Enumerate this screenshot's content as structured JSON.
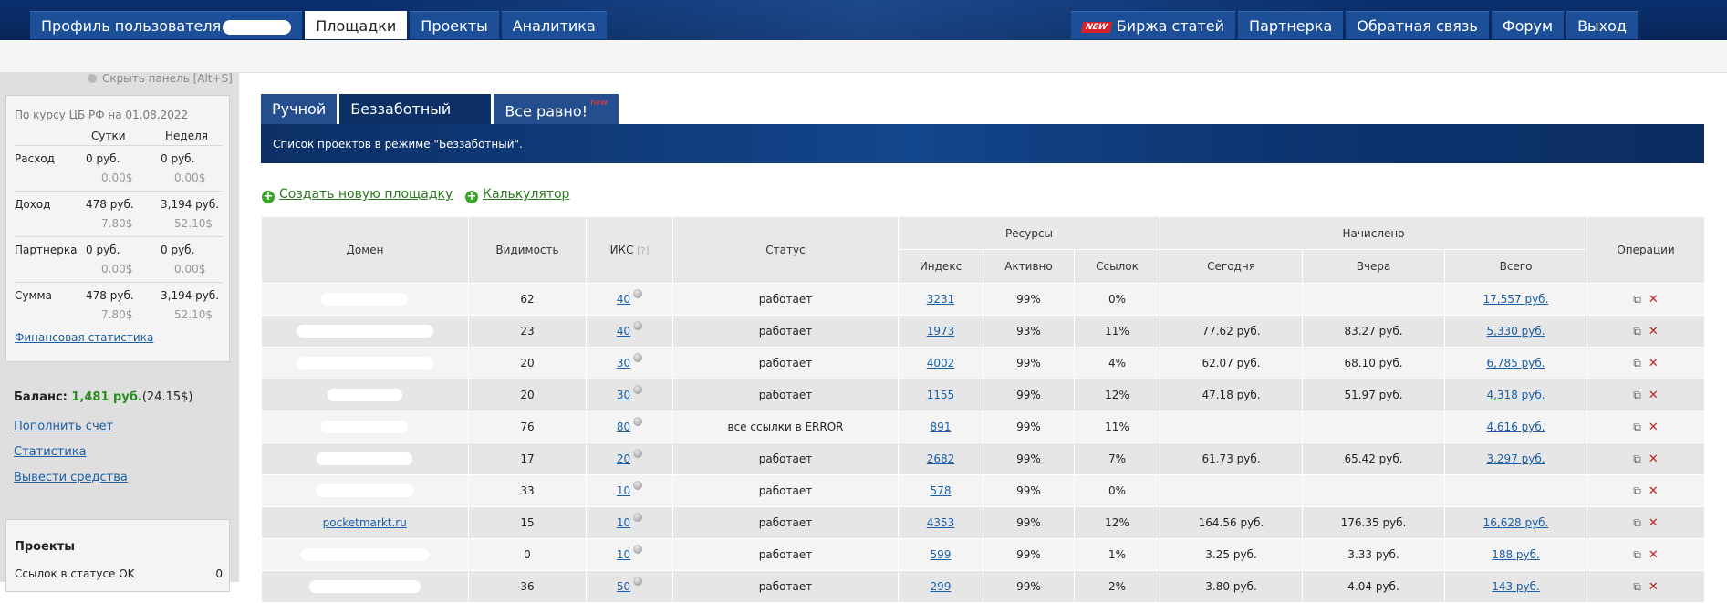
{
  "topnav": {
    "left": [
      {
        "label": "Профиль пользователя",
        "active": false
      },
      {
        "label": "Площадки",
        "active": true
      },
      {
        "label": "Проекты",
        "active": false
      },
      {
        "label": "Аналитика",
        "active": false
      }
    ],
    "right": [
      {
        "label": "Биржа статей",
        "badge": "NEW"
      },
      {
        "label": "Партнерка"
      },
      {
        "label": "Обратная связь"
      },
      {
        "label": "Форум"
      },
      {
        "label": "Выход"
      }
    ]
  },
  "sidebar": {
    "hide_panel": "Скрыть панель [Alt+S]",
    "fin": {
      "date": "По курсу ЦБ РФ на 01.08.2022",
      "col_day": "Сутки",
      "col_week": "Неделя",
      "rows": [
        {
          "label": "Расход",
          "day": "0 руб.",
          "week": "0 руб.",
          "day_usd": "0.00$",
          "week_usd": "0.00$"
        },
        {
          "label": "Доход",
          "day": "478 руб.",
          "week": "3,194 руб.",
          "day_usd": "7.80$",
          "week_usd": "52.10$"
        },
        {
          "label": "Партнерка",
          "day": "0 руб.",
          "week": "0 руб.",
          "day_usd": "0.00$",
          "week_usd": "0.00$"
        },
        {
          "label": "Сумма",
          "day": "478 руб.",
          "week": "3,194 руб.",
          "day_usd": "7.80$",
          "week_usd": "52.10$"
        }
      ],
      "link": "Финансовая статистика"
    },
    "balance_label": "Баланс:",
    "balance_value": "1,481 руб.",
    "balance_usd": "(24.15$)",
    "links": [
      "Пополнить счет",
      "Статистика",
      "Вывести средства"
    ],
    "projects_title": "Проекты",
    "projects_row_label": "Ссылок в статусе OK",
    "projects_row_value": "0"
  },
  "main": {
    "tabs": [
      {
        "label": "Ручной"
      },
      {
        "label": "Беззаботный",
        "active": true
      },
      {
        "label": "Все равно!",
        "sup": "new"
      }
    ],
    "banner": "Список проектов в режиме \"Беззаботный\".",
    "actions": [
      "Создать новую площадку",
      "Калькулятор"
    ],
    "table": {
      "headers": {
        "domain": "Домен",
        "visibility": "Видимость",
        "iks": "ИКС",
        "iks_q": "[?]",
        "status": "Статус",
        "resources": "Ресурсы",
        "accrued": "Начислено",
        "ops": "Операции",
        "index": "Индекс",
        "active": "Активно",
        "links": "Ссылок",
        "today": "Сегодня",
        "yesterday": "Вчера",
        "total": "Всего"
      },
      "rows": [
        {
          "domain": "",
          "vis": "62",
          "iks": "40",
          "status": "работает",
          "index": "3231",
          "active": "99%",
          "links": "0%",
          "today": "",
          "yesterday": "",
          "total": "17,557 руб."
        },
        {
          "domain": "",
          "vis": "23",
          "iks": "40",
          "status": "работает",
          "index": "1973",
          "active": "93%",
          "links": "11%",
          "today": "77.62 руб.",
          "yesterday": "83.27 руб.",
          "total": "5,330 руб."
        },
        {
          "domain": "",
          "vis": "20",
          "iks": "30",
          "status": "работает",
          "index": "4002",
          "active": "99%",
          "links": "4%",
          "today": "62.07 руб.",
          "yesterday": "68.10 руб.",
          "total": "6,785 руб."
        },
        {
          "domain": "",
          "vis": "20",
          "iks": "30",
          "status": "работает",
          "index": "1155",
          "active": "99%",
          "links": "12%",
          "today": "47.18 руб.",
          "yesterday": "51.97 руб.",
          "total": "4,318 руб."
        },
        {
          "domain": "",
          "vis": "76",
          "iks": "80",
          "status": "все ссылки в ERROR",
          "index": "891",
          "active": "99%",
          "links": "11%",
          "today": "",
          "yesterday": "",
          "total": "4,616 руб."
        },
        {
          "domain": "",
          "vis": "17",
          "iks": "20",
          "status": "работает",
          "index": "2682",
          "active": "99%",
          "links": "7%",
          "today": "61.73 руб.",
          "yesterday": "65.42 руб.",
          "total": "3,297 руб."
        },
        {
          "domain": "",
          "vis": "33",
          "iks": "10",
          "status": "работает",
          "index": "578",
          "active": "99%",
          "links": "0%",
          "today": "",
          "yesterday": "",
          "total": ""
        },
        {
          "domain": "pocketmarkt.ru",
          "vis": "15",
          "iks": "10",
          "status": "работает",
          "index": "4353",
          "active": "99%",
          "links": "12%",
          "today": "164.56 руб.",
          "yesterday": "176.35 руб.",
          "total": "16,628 руб."
        },
        {
          "domain": "",
          "vis": "0",
          "iks": "10",
          "status": "работает",
          "index": "599",
          "active": "99%",
          "links": "1%",
          "today": "3.25 руб.",
          "yesterday": "3.33 руб.",
          "total": "188 руб."
        },
        {
          "domain": "",
          "vis": "36",
          "iks": "50",
          "status": "работает",
          "index": "299",
          "active": "99%",
          "links": "2%",
          "today": "3.80 руб.",
          "yesterday": "4.04 руб.",
          "total": "143 руб."
        }
      ]
    }
  },
  "colors": {
    "nav_bg": "#0a2a63",
    "nav_item": "#1d4f98",
    "link": "#1a5ea8",
    "green": "#2a8a1e",
    "delete": "#c8201c"
  }
}
